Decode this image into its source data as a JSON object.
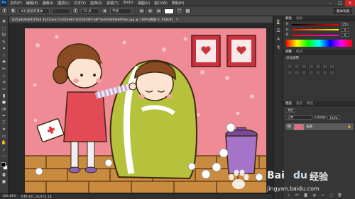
{
  "app": {
    "logo": "Ps"
  },
  "menu": [
    "文件(F)",
    "编辑(E)",
    "图像(I)",
    "图层(L)",
    "文字(Y)",
    "选择(S)",
    "滤镜(T)",
    "3D(D)",
    "视图(V)",
    "窗口(W)",
    "帮助(H)"
  ],
  "window_controls": {
    "minimize": "–",
    "maximize": "□",
    "close": "✕"
  },
  "options": {
    "orientation_icon": "text-orientation-icon",
    "font_family": "文长超级黑篆体",
    "font_style": "-",
    "size_icon": "font-size-icon",
    "font_size": "72 点",
    "aa_icon": "anti-alias-icon",
    "anti_alias": "平滑",
    "text_color": "#ffffff",
    "workspace": "基本功能"
  },
  "document": {
    "tab_title": "b25a8a9e642f3b4 4b51aea15a32be83 6c626c9b7a8f 9a0a08d0a60fdec.jpg @ 100%(图层 0, RGB/8)",
    "close": "×"
  },
  "status": {
    "zoom": "100.44%",
    "doc_size": "文档:401.1K/474.1K"
  },
  "color_panel": {
    "tabs": [
      "颜色",
      "色板"
    ],
    "sliders": [
      {
        "label": "R",
        "value": "255"
      },
      {
        "label": "G",
        "value": "0"
      },
      {
        "label": "B",
        "value": "0"
      }
    ]
  },
  "adjustments_panel": {
    "tabs": [
      "调整",
      "样式"
    ],
    "caption": "添加调整"
  },
  "layers_panel": {
    "tabs": [
      "图层",
      "通道",
      "路径"
    ],
    "kind": "类型",
    "mode": "正常",
    "opacity_label": "不透明度:",
    "opacity": "100%",
    "layer_name": "背景",
    "lock_icon": "lock-icon"
  },
  "watermark": {
    "brand": "Bai",
    "brand2": "du",
    "suffix": "经验",
    "url": "jingyan.baidu.com"
  }
}
